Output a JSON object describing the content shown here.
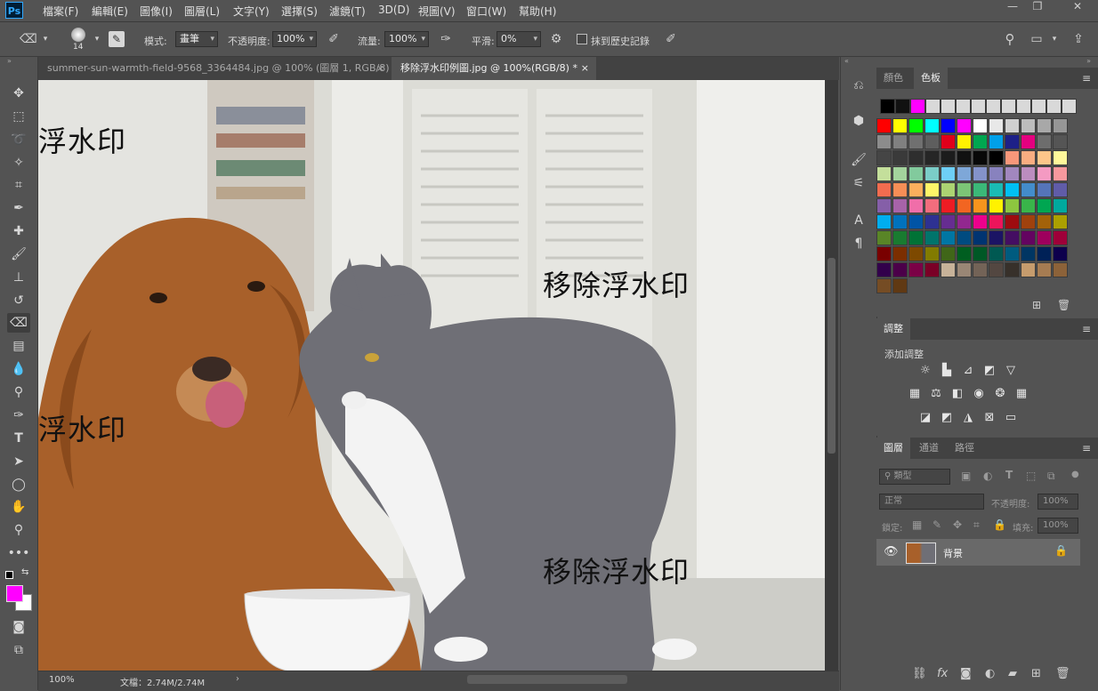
{
  "app": {
    "logo": "Ps"
  },
  "menu": [
    "檔案(F)",
    "編輯(E)",
    "圖像(I)",
    "圖層(L)",
    "文字(Y)",
    "選擇(S)",
    "濾鏡(T)",
    "3D(D)",
    "視圖(V)",
    "窗口(W)",
    "幫助(H)"
  ],
  "window_controls": {
    "minimize": "—",
    "restore": "❐",
    "close": "✕"
  },
  "options": {
    "brush_size": "14",
    "mode_label": "模式:",
    "mode_value": "畫筆",
    "opacity_label": "不透明度:",
    "opacity_value": "100%",
    "flow_label": "流量:",
    "flow_value": "100%",
    "smooth_label": "平滑:",
    "smooth_value": "0%",
    "erase_history_label": "抹到歷史記錄"
  },
  "tabs": [
    {
      "label": "summer-sun-warmth-field-9568_3364484.jpg @ 100% (圖層 1, RGB/8) *",
      "close": "×"
    },
    {
      "label": "移除浮水印例圖.jpg @ 100%(RGB/8) *",
      "close": "×"
    }
  ],
  "canvas": {
    "watermarks": [
      "浮水印",
      "移除浮水印",
      "浮水印",
      "移除浮水印"
    ]
  },
  "status": {
    "zoom": "100%",
    "doc": "文檔：2.74M/2.74M"
  },
  "color_panel": {
    "tabs": [
      "顏色",
      "色板"
    ],
    "active": 1
  },
  "swatches": {
    "top_row": [
      "#000000",
      "#111111",
      "#ff00ff",
      "#d9d9d9",
      "#d9d9d9",
      "#d9d9d9",
      "#d9d9d9",
      "#d9d9d9",
      "#d9d9d9",
      "#d9d9d9",
      "#d9d9d9",
      "#d9d9d9",
      "#d9d9d9"
    ],
    "grid": [
      [
        "#ff0000",
        "#ffff00",
        "#00ff00",
        "#00ffff",
        "#0000ff",
        "#ff00ff",
        "#ffffff",
        "#e8e8e8",
        "#d0d0d0",
        "#bdbdbd",
        "#a8a8a8",
        "#969696"
      ],
      [
        "#8c8c8c",
        "#808080",
        "#707070",
        "#5e5e5e",
        "#e0001a",
        "#fff100",
        "#00a650",
        "#00a0e9",
        "#1d2088",
        "#e4007f",
        "#6d6d6d",
        "#555555"
      ],
      [
        "#454545",
        "#3a3a3a",
        "#2e2e2e",
        "#262626",
        "#1c1c1c",
        "#111111",
        "#080808",
        "#000000",
        "#f7977a",
        "#f9ad81",
        "#fdc68a",
        "#fff79a"
      ],
      [
        "#c4df9b",
        "#a3d39c",
        "#82ca9d",
        "#7bcdc8",
        "#6ecff6",
        "#7ea7d8",
        "#8493ca",
        "#8882be",
        "#a187be",
        "#bc8dbf",
        "#f49ac2",
        "#f6989d"
      ],
      [
        "#f26c4f",
        "#f68e56",
        "#fbaf5d",
        "#fff568",
        "#acd372",
        "#7cc576",
        "#3bb878",
        "#1abbb4",
        "#00bff3",
        "#438ccb",
        "#5574b9",
        "#605ca8"
      ],
      [
        "#855fa8",
        "#a763a8",
        "#f06ea9",
        "#f26d7d",
        "#ed1c24",
        "#f26522",
        "#f7941d",
        "#fff200",
        "#8dc63f",
        "#39b54a",
        "#00a651",
        "#00a99d"
      ],
      [
        "#00aeef",
        "#0072bc",
        "#0054a6",
        "#2e3192",
        "#662d91",
        "#92278f",
        "#ec008c",
        "#ed145b",
        "#9e0b0f",
        "#a0410d",
        "#a36209",
        "#aba000"
      ],
      [
        "#598527",
        "#197b30",
        "#007236",
        "#00746b",
        "#0076a3",
        "#004b80",
        "#003471",
        "#1b1464",
        "#440e62",
        "#630460",
        "#9e005d",
        "#9e0039"
      ],
      [
        "#790000",
        "#7b2e00",
        "#7d4900",
        "#827b00",
        "#406618",
        "#005e20",
        "#005826",
        "#005952",
        "#005b7f",
        "#003663",
        "#002157",
        "#0d004c"
      ],
      [
        "#32004b",
        "#4b0049",
        "#7b0046",
        "#7a0026",
        "#c7b299",
        "#998675",
        "#736357",
        "#534741",
        "#37302a",
        "#c69c6d",
        "#a67c52",
        "#8c6239"
      ],
      [
        "#754c24",
        "#603913"
      ]
    ]
  },
  "adjust_panel": {
    "tab": "調整",
    "add_label": "添加調整",
    "rows": [
      [
        "brightness-icon",
        "levels-icon",
        "curves-icon",
        "exposure-icon",
        "vibrance-icon"
      ],
      [
        "hue-saturation-icon",
        "color-balance-icon",
        "black-white-icon",
        "photo-filter-icon",
        "channel-mixer-icon",
        "color-lookup-icon"
      ],
      [
        "invert-icon",
        "posterize-icon",
        "threshold-icon",
        "selective-color-icon",
        "gradient-map-icon"
      ]
    ]
  },
  "layers_panel": {
    "tabs": [
      "圖層",
      "通道",
      "路徑"
    ],
    "active": 0,
    "filter_label": "類型",
    "blend_mode": "正常",
    "opacity_label": "不透明度:",
    "opacity_value": "100%",
    "lock_label": "鎖定:",
    "fill_label": "填充:",
    "fill_value": "100%",
    "layers": [
      {
        "name": "背景",
        "visible": true,
        "locked": true
      }
    ],
    "bottom_icons": [
      "link-icon",
      "fx-icon",
      "mask-icon",
      "adjustment-icon",
      "folder-icon",
      "new-layer-icon",
      "trash-icon"
    ]
  }
}
